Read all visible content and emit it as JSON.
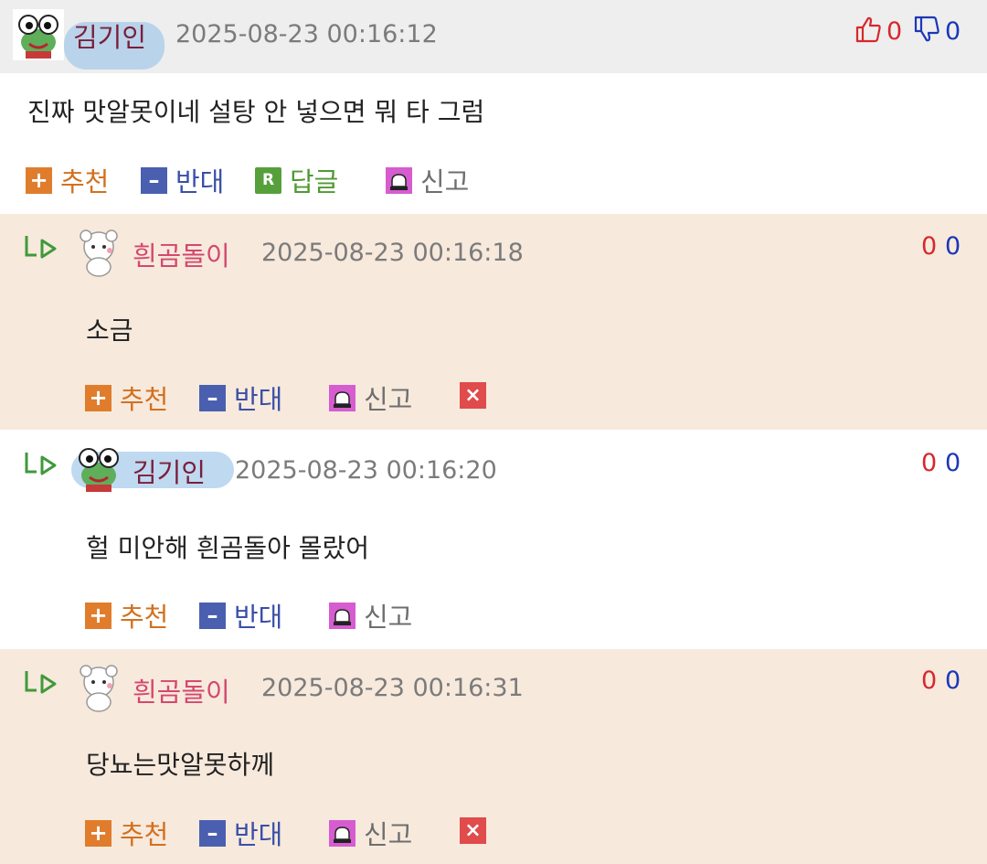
{
  "comments": [
    {
      "author": "김기인",
      "date": "2025-08-23 00:16:12",
      "content": "진짜 맛알못이네 설탕 안 넣으면 뭐 타 그럼",
      "up": "0",
      "down": "0"
    },
    {
      "author": "흰곰돌이",
      "date": "2025-08-23 00:16:18",
      "content": "소금",
      "up": "0",
      "down": "0"
    },
    {
      "author": "김기인",
      "date": "2025-08-23 00:16:20",
      "content": "헐 미안해 흰곰돌아 몰랐어",
      "up": "0",
      "down": "0"
    },
    {
      "author": "흰곰돌이",
      "date": "2025-08-23 00:16:31",
      "content": "당뇨는맛알못하께",
      "up": "0",
      "down": "0"
    }
  ],
  "actions": {
    "recommend": "추천",
    "oppose": "반대",
    "reply": "답글",
    "report": "신고"
  },
  "icons": {
    "plus": "+",
    "minus": "–",
    "reply_badge": "R",
    "delete": "×",
    "thumb_up": "thumbs-up-icon",
    "thumb_down": "thumbs-down-icon",
    "reply_arrow": "reply-arrow-icon",
    "siren": "siren-icon",
    "frog_avatar": "frog-avatar-icon",
    "bear_avatar": "bear-avatar-icon"
  },
  "colors": {
    "header_bg": "#eeeeee",
    "reply_bg": "#f7e9dc",
    "recommend": "#d2711f",
    "oppose": "#3a4fa8",
    "reply": "#4f9a33",
    "up_count": "#d6282d",
    "down_count": "#1b37b8"
  }
}
